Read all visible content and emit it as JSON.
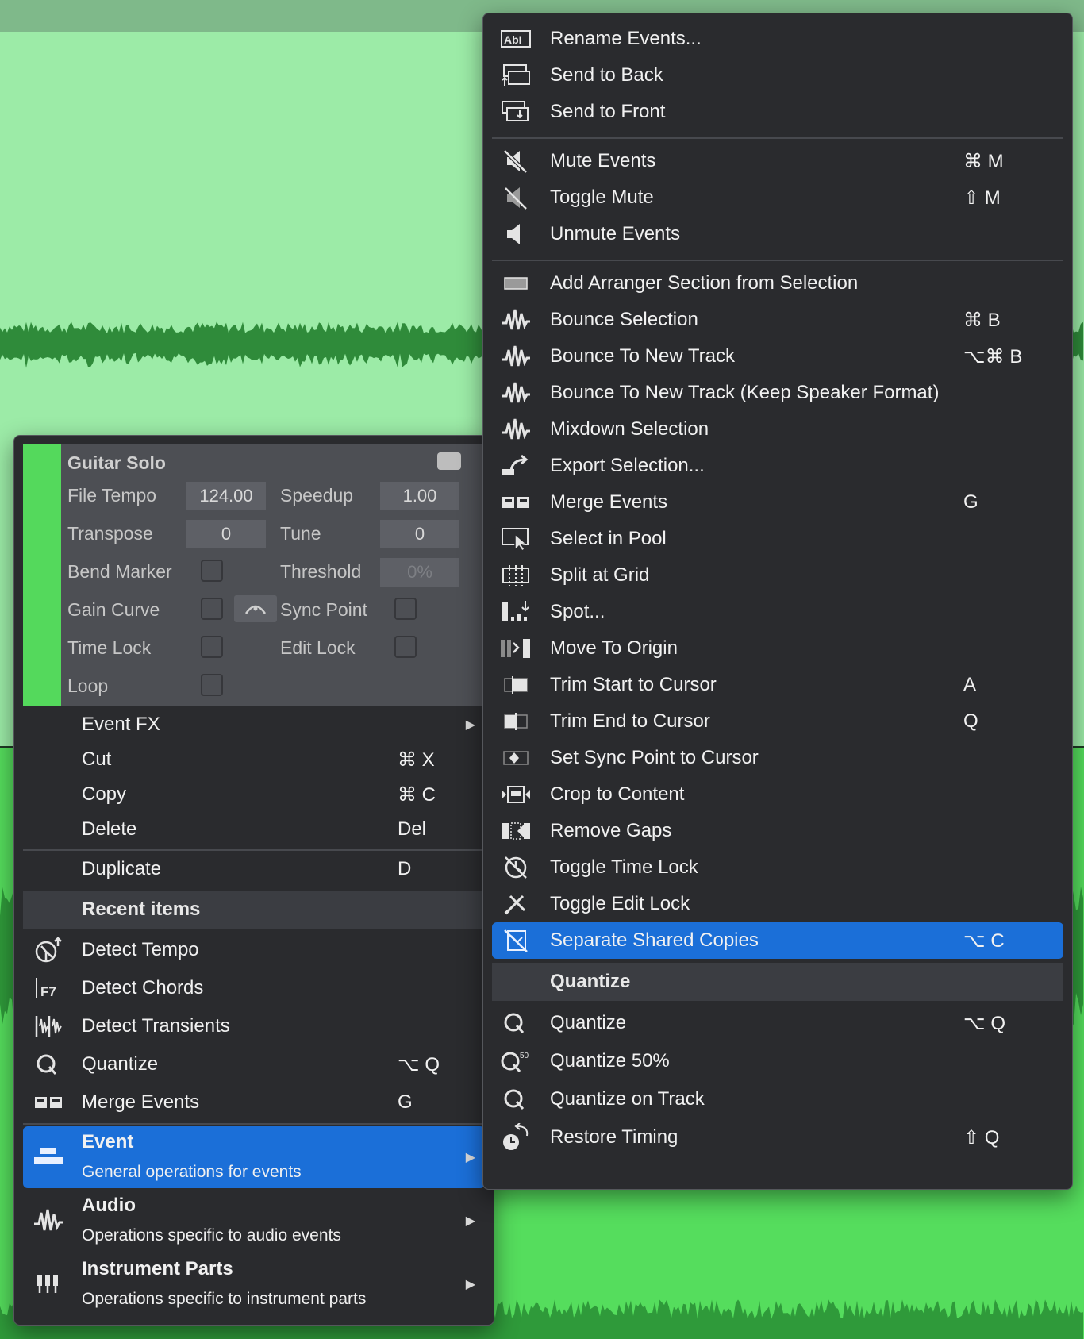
{
  "colors": {
    "menu_bg": "#2a2b2e",
    "highlight": "#1b6fd8",
    "event_color": "#54d95c",
    "section_header": "#3b3d42"
  },
  "right_menu": {
    "items": [
      {
        "label": "Rename Events...",
        "shortcut": "",
        "icon": "rename-icon"
      },
      {
        "label": "Send to Back",
        "shortcut": "",
        "icon": "send-to-back-icon"
      },
      {
        "label": "Send to Front",
        "shortcut": "",
        "icon": "send-to-front-icon"
      },
      {
        "label": "Mute Events",
        "shortcut": "⌘ M",
        "icon": "mute-icon"
      },
      {
        "label": "Toggle Mute",
        "shortcut": "⇧ M",
        "icon": "toggle-mute-icon"
      },
      {
        "label": "Unmute Events",
        "shortcut": "",
        "icon": "speaker-icon"
      },
      {
        "label": "Add Arranger Section from Selection",
        "shortcut": "",
        "icon": "arranger-section-icon"
      },
      {
        "label": "Bounce Selection",
        "shortcut": "⌘ B",
        "icon": "waveform-icon"
      },
      {
        "label": "Bounce To New Track",
        "shortcut": "⌥⌘ B",
        "icon": "waveform-icon"
      },
      {
        "label": "Bounce To New Track (Keep Speaker Format)",
        "shortcut": "",
        "icon": "waveform-icon"
      },
      {
        "label": "Mixdown Selection",
        "shortcut": "",
        "icon": "waveform-icon"
      },
      {
        "label": "Export Selection...",
        "shortcut": "",
        "icon": "export-icon"
      },
      {
        "label": "Merge Events",
        "shortcut": "G",
        "icon": "merge-icon"
      },
      {
        "label": "Select in Pool",
        "shortcut": "",
        "icon": "select-in-pool-icon"
      },
      {
        "label": "Split at Grid",
        "shortcut": "",
        "icon": "split-grid-icon"
      },
      {
        "label": "Spot...",
        "shortcut": "",
        "icon": "spot-icon"
      },
      {
        "label": "Move To Origin",
        "shortcut": "",
        "icon": "move-origin-icon"
      },
      {
        "label": "Trim Start to Cursor",
        "shortcut": "A",
        "icon": "trim-start-icon"
      },
      {
        "label": "Trim End to Cursor",
        "shortcut": "Q",
        "icon": "trim-end-icon"
      },
      {
        "label": "Set Sync Point to Cursor",
        "shortcut": "",
        "icon": "sync-point-icon"
      },
      {
        "label": "Crop to Content",
        "shortcut": "",
        "icon": "crop-icon"
      },
      {
        "label": "Remove Gaps",
        "shortcut": "",
        "icon": "remove-gaps-icon"
      },
      {
        "label": "Toggle Time Lock",
        "shortcut": "",
        "icon": "time-lock-icon"
      },
      {
        "label": "Toggle Edit Lock",
        "shortcut": "",
        "icon": "edit-lock-icon"
      },
      {
        "label": "Separate Shared Copies",
        "shortcut": "⌥ C",
        "icon": "separate-copies-icon"
      }
    ],
    "quantize_header": "Quantize",
    "quantize_items": [
      {
        "label": "Quantize",
        "shortcut": "⌥ Q",
        "icon": "quantize-icon"
      },
      {
        "label": "Quantize 50%",
        "shortcut": "",
        "icon": "quantize-50-icon"
      },
      {
        "label": "Quantize on Track",
        "shortcut": "",
        "icon": "quantize-track-icon"
      },
      {
        "label": "Restore Timing",
        "shortcut": "⇧ Q",
        "icon": "restore-timing-icon"
      }
    ]
  },
  "left_menu": {
    "inspector": {
      "title": "Guitar Solo",
      "file_tempo_label": "File Tempo",
      "file_tempo_value": "124.00",
      "speedup_label": "Speedup",
      "speedup_value": "1.00",
      "transpose_label": "Transpose",
      "transpose_value": "0",
      "tune_label": "Tune",
      "tune_value": "0",
      "bend_marker_label": "Bend Marker",
      "threshold_label": "Threshold",
      "threshold_value": "0%",
      "gain_curve_label": "Gain Curve",
      "sync_point_label": "Sync Point",
      "time_lock_label": "Time Lock",
      "edit_lock_label": "Edit Lock",
      "loop_label": "Loop"
    },
    "items": [
      {
        "label": "Event FX",
        "shortcut": ""
      },
      {
        "label": "Cut",
        "shortcut": "⌘ X"
      },
      {
        "label": "Copy",
        "shortcut": "⌘ C"
      },
      {
        "label": "Delete",
        "shortcut": "Del"
      },
      {
        "label": "Duplicate",
        "shortcut": "D"
      }
    ],
    "recent_header": "Recent items",
    "recent_items": [
      {
        "label": "Detect Tempo",
        "shortcut": "",
        "icon": "detect-tempo-icon"
      },
      {
        "label": "Detect Chords",
        "shortcut": "",
        "icon": "detect-chords-icon"
      },
      {
        "label": "Detect Transients",
        "shortcut": "",
        "icon": "detect-transients-icon"
      },
      {
        "label": "Quantize",
        "shortcut": "⌥ Q",
        "icon": "quantize-icon"
      },
      {
        "label": "Merge Events",
        "shortcut": "G",
        "icon": "merge-icon"
      }
    ],
    "categories": [
      {
        "title": "Event",
        "subtitle": "General operations for events",
        "icon": "event-icon"
      },
      {
        "title": "Audio",
        "subtitle": "Operations specific to audio events",
        "icon": "audio-icon"
      },
      {
        "title": "Instrument Parts",
        "subtitle": "Operations specific to instrument parts",
        "icon": "instrument-icon"
      }
    ]
  }
}
